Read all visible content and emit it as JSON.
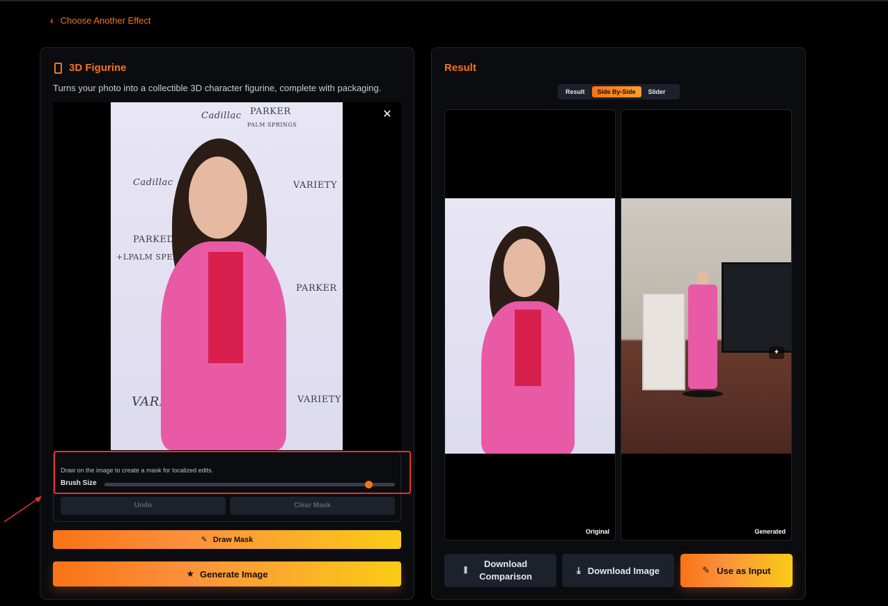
{
  "nav": {
    "back_label": "Choose Another Effect"
  },
  "effect": {
    "title": "3D Figurine",
    "description": "Turns your photo into a collectible 3D character figurine, complete with packaging."
  },
  "mask": {
    "hint": "Draw on the image to create a mask for localized edits.",
    "brush_label": "Brush Size",
    "brush_value_fraction": 0.91,
    "undo_label": "Undo",
    "clear_label": "Clear Mask"
  },
  "buttons": {
    "draw_mask": "Draw Mask",
    "generate": "Generate Image"
  },
  "result": {
    "title": "Result",
    "view_modes": [
      "Result",
      "Side By-Side",
      "Slider"
    ],
    "active_view": "Side By-Side",
    "original_label": "Original",
    "generated_label": "Generated",
    "download_comparison": "Download Comparison",
    "download_image": "Download Image",
    "use_as_input": "Use as Input"
  },
  "photo_text": {
    "parker": "PARKER",
    "palm_springs": "PALM SPRINGS",
    "cadillac": "Cadillac",
    "parked": "PARKED",
    "palm_spere": "+LPALM SPERE",
    "variety": "VARIETY"
  },
  "colors": {
    "accent": "#f97316",
    "accent_end": "#facc15",
    "panel_bg": "#0b0c10",
    "annotation_red": "#e8332c"
  },
  "icons": {
    "back": "chevron-left-icon",
    "effect": "phone-icon",
    "close": "close-icon",
    "draw": "pencil-icon",
    "generate": "star-icon",
    "comparison": "sliders-icon",
    "download": "download-icon",
    "use_input": "edit-icon",
    "expand": "magic-wand-icon"
  }
}
